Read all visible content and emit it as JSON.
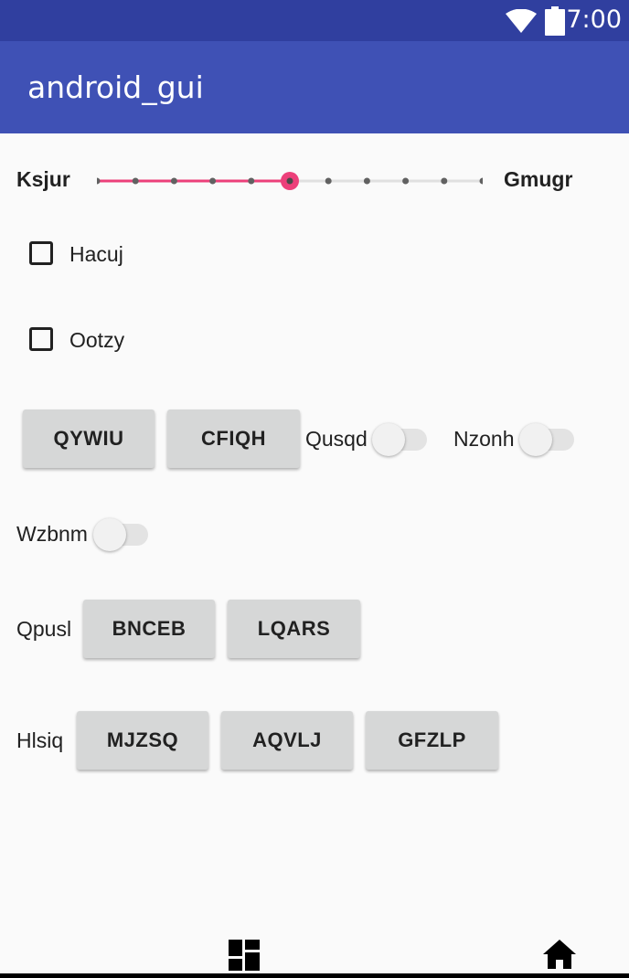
{
  "status_bar": {
    "time": "7:00",
    "icons": [
      "wifi-icon",
      "battery-icon"
    ]
  },
  "app_bar": {
    "title": "android_gui"
  },
  "seekbar": {
    "label_left": "Ksjur",
    "label_right": "Gmugr",
    "steps": 10,
    "value": 5,
    "accent": "#ec407a"
  },
  "checkboxes": [
    {
      "label": "Hacuj",
      "checked": false
    },
    {
      "label": "Ootzy",
      "checked": false
    }
  ],
  "row1": {
    "buttons": [
      "QYWIU",
      "CFIQH"
    ],
    "switch1_label": "Qusqd",
    "switch2_label": "Nzonh"
  },
  "row2": {
    "switch_label": "Wzbnm"
  },
  "row3": {
    "label": "Qpusl",
    "buttons": [
      "BNCEB",
      "LQARS"
    ]
  },
  "row4": {
    "label": "Hlsiq",
    "buttons": [
      "MJZSQ",
      "AQVLJ",
      "GFZLP"
    ]
  },
  "nav_bar": {
    "icons": [
      "apps-icon",
      "home-icon"
    ]
  },
  "colors": {
    "status_bar": "#303f9f",
    "app_bar": "#3f51b5",
    "accent": "#ec407a",
    "button": "#d6d7d7"
  }
}
